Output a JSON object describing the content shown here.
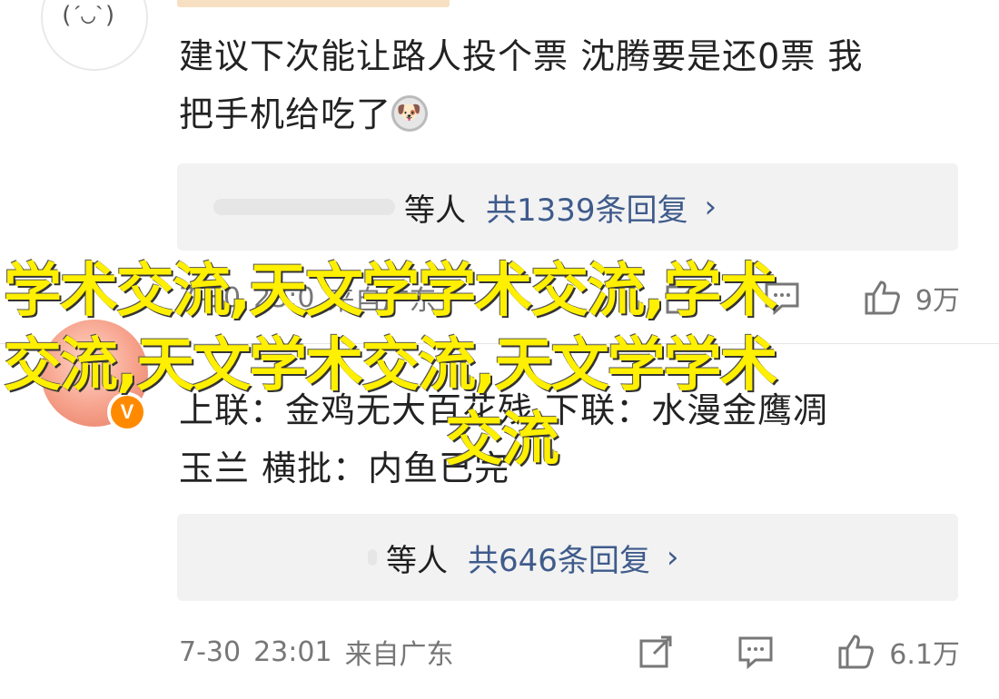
{
  "comments": [
    {
      "text_line1": "建议下次能让路人投个票 沈腾要是还0票 我",
      "text_line2": "把手机给吃了",
      "emoji_icon": "dog-face-icon",
      "reply_preview": {
        "suffix": "等人",
        "count_label": "共1339条回复"
      },
      "meta": {
        "date": "7-30",
        "time": "23:0",
        "source": "来自广东",
        "likes": "9万"
      }
    },
    {
      "text_line1": "上联：金鸡无大百花残 下联：水漫金鹰凋",
      "text_line2": "玉兰 横批：内鱼已完",
      "badge": "V",
      "reply_preview": {
        "suffix": "等人",
        "count_label": "共646条回复"
      },
      "meta": {
        "date": "7-30",
        "time": "23:01",
        "source": "来自广东",
        "likes": "6.1万"
      }
    }
  ],
  "watermark": {
    "line1": "学术交流,天文学学术交流,学术",
    "line2": "交流,天文学术交流,天文学学术",
    "line3": "交流"
  },
  "colors": {
    "link": "#3f5b8c",
    "watermark": "#ffef00",
    "reply_bg": "#f2f2f2",
    "badge": "#ff8a00"
  }
}
